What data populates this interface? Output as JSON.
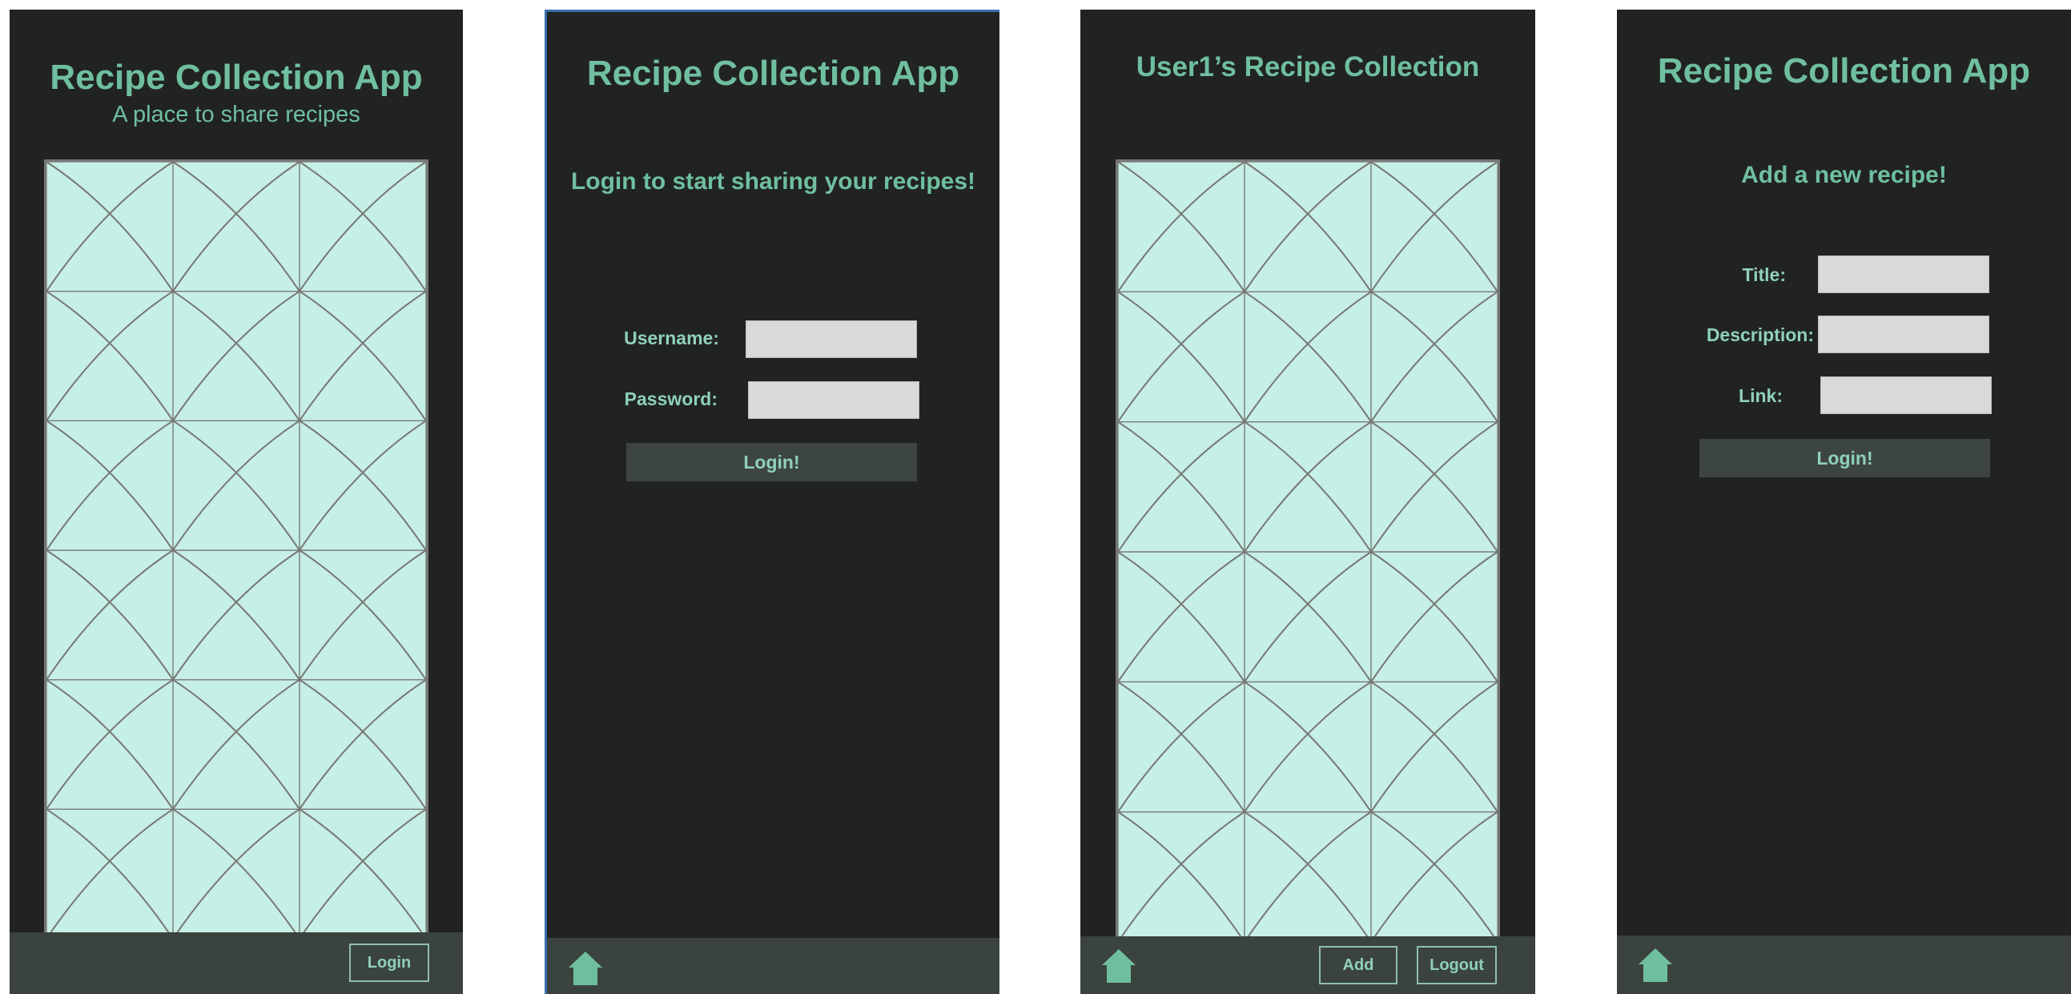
{
  "screens": {
    "home": {
      "title": "Recipe Collection App",
      "subtitle": "A place to share recipes",
      "login_button": "Login"
    },
    "login": {
      "title": "Recipe Collection App",
      "heading": "Login to start sharing your recipes!",
      "username_label": "Username:",
      "password_label": "Password:",
      "username_value": "",
      "password_value": "",
      "submit_button": "Login!"
    },
    "collection": {
      "title": "User1’s Recipe Collection",
      "add_button": "Add",
      "logout_button": "Logout"
    },
    "add_recipe": {
      "title": "Recipe Collection App",
      "heading": "Add a new recipe!",
      "title_label": "Title:",
      "description_label": "Description:",
      "link_label": "Link:",
      "title_value": "",
      "description_value": "",
      "link_value": "",
      "submit_button": "Login!"
    }
  },
  "colors": {
    "background": "#212322",
    "accent": "#6fbf9f",
    "bottom_bar": "#3b433f",
    "placeholder_fill": "#c6efe5",
    "input_fill": "#d9d9d9"
  },
  "icons": {
    "home": "home-icon"
  }
}
